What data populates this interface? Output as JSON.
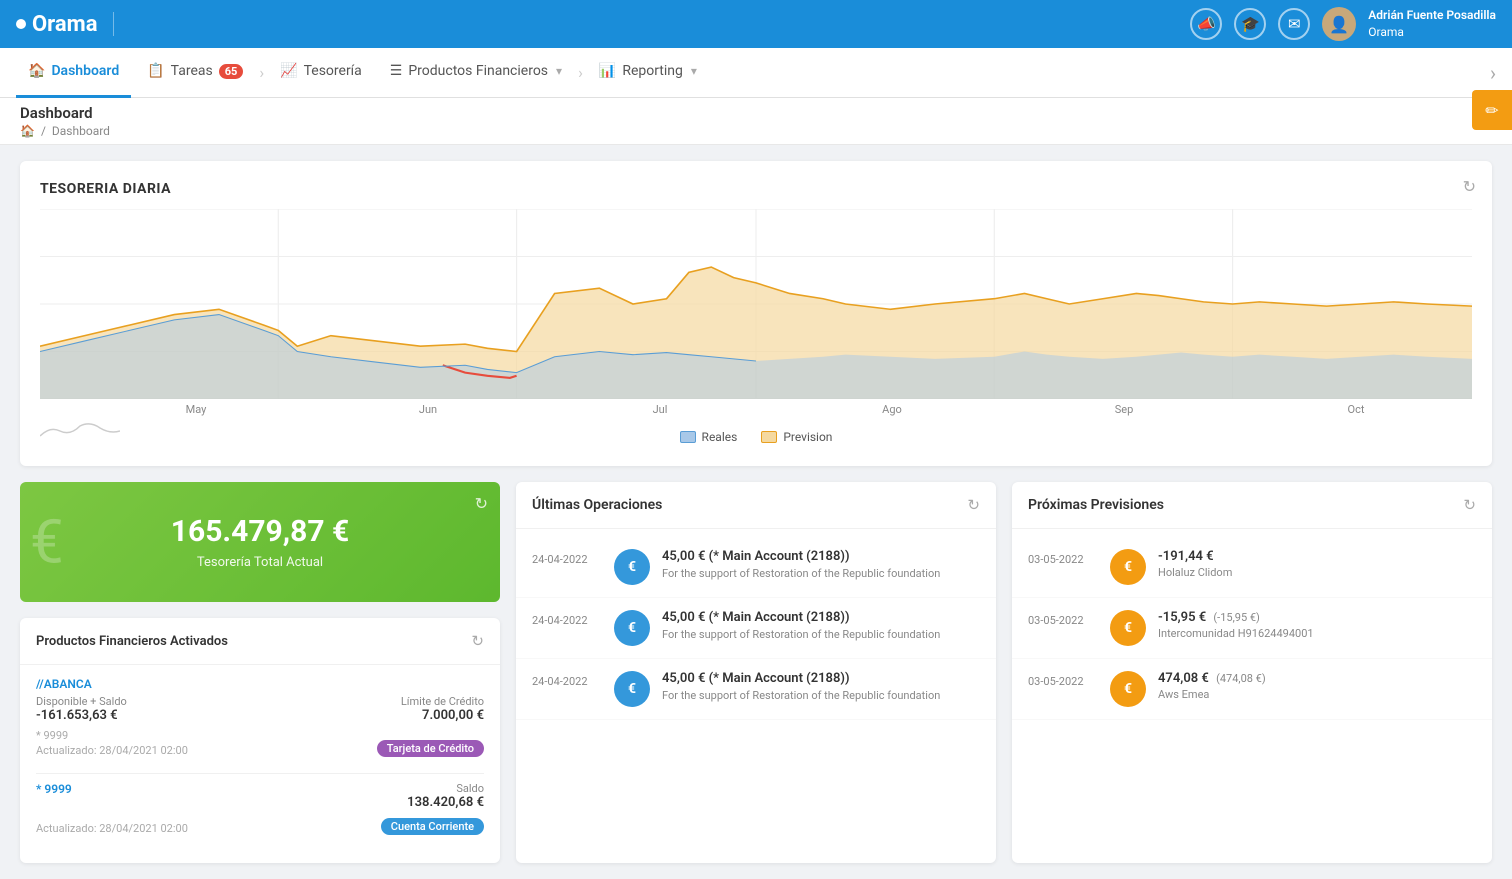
{
  "app": {
    "logo": "•Orama",
    "logo_dot": "•"
  },
  "topnav": {
    "icons": [
      "📣",
      "🎓",
      "✉"
    ],
    "user": {
      "name": "Adrián Fuente Posadilla",
      "company": "Orama"
    }
  },
  "secondnav": {
    "items": [
      {
        "icon": "🏠",
        "label": "Dashboard",
        "active": true
      },
      {
        "icon": "📋",
        "label": "Tareas",
        "badge": "65"
      },
      {
        "icon": "📈",
        "label": "Tesorería"
      },
      {
        "icon": "☰",
        "label": "Productos Financieros",
        "expand": true
      },
      {
        "icon": "📊",
        "label": "Reporting",
        "expand": true
      }
    ]
  },
  "breadcrumb": {
    "page_title": "Dashboard",
    "home_icon": "🏠",
    "path": "Dashboard"
  },
  "chart": {
    "title": "TESORERIA DIARIA",
    "x_labels": [
      "May",
      "Jun",
      "Jul",
      "Ago",
      "Sep",
      "Oct"
    ],
    "legend": [
      {
        "label": "Reales",
        "color": "#a8c8e8"
      },
      {
        "label": "Prevision",
        "color": "#f5d9a0"
      }
    ],
    "refresh_icon": "↻"
  },
  "treasury_card": {
    "amount": "165.479,87 €",
    "label": "Tesorería Total Actual",
    "refresh_icon": "↻"
  },
  "products_card": {
    "title": "Productos Financieros Activados",
    "refresh_icon": "↻",
    "items": [
      {
        "name": "//ABANCA",
        "balance_label": "Disponible + Saldo",
        "balance_value": "-161.653,63 €",
        "detail_label": "* 9999",
        "updated": "Actualizado: 28/04/2021 02:00",
        "credit_label": "Límite de Crédito",
        "credit_value": "7.000,00 €",
        "badge": "Tarjeta de Crédito",
        "badge_class": "badge-purple"
      },
      {
        "name": "* 9999",
        "balance_label": "Saldo",
        "balance_value": "138.420,68 €",
        "updated": "Actualizado: 28/04/2021 02:00",
        "badge": "Cuenta Corriente",
        "badge_class": "badge-blue"
      }
    ]
  },
  "operations_card": {
    "title": "Últimas Operaciones",
    "refresh_icon": "↻",
    "items": [
      {
        "date": "24-04-2022",
        "icon": "€",
        "amount": "45,00 € (* Main Account (2188))",
        "desc": "For the support of Restoration of the Republic foundation"
      },
      {
        "date": "24-04-2022",
        "icon": "€",
        "amount": "45,00 € (* Main Account (2188))",
        "desc": "For the support of Restoration of the Republic foundation"
      },
      {
        "date": "24-04-2022",
        "icon": "€",
        "amount": "45,00 € (* Main Account (2188))",
        "desc": "For the support of Restoration of the Republic foundation"
      }
    ]
  },
  "previsions_card": {
    "title": "Próximas Previsiones",
    "refresh_icon": "↻",
    "items": [
      {
        "date": "03-05-2022",
        "icon": "€",
        "amount": "-191,44 €",
        "secondary": "",
        "name": "Holaluz Clidom"
      },
      {
        "date": "03-05-2022",
        "icon": "€",
        "amount": "-15,95 €",
        "secondary": "(-15,95 €)",
        "name": "Intercomunidad H91624494001"
      },
      {
        "date": "03-05-2022",
        "icon": "€",
        "amount": "474,08 €",
        "secondary": "(474,08 €)",
        "name": "Aws Emea"
      }
    ]
  },
  "fab": {
    "icon": "✏"
  }
}
